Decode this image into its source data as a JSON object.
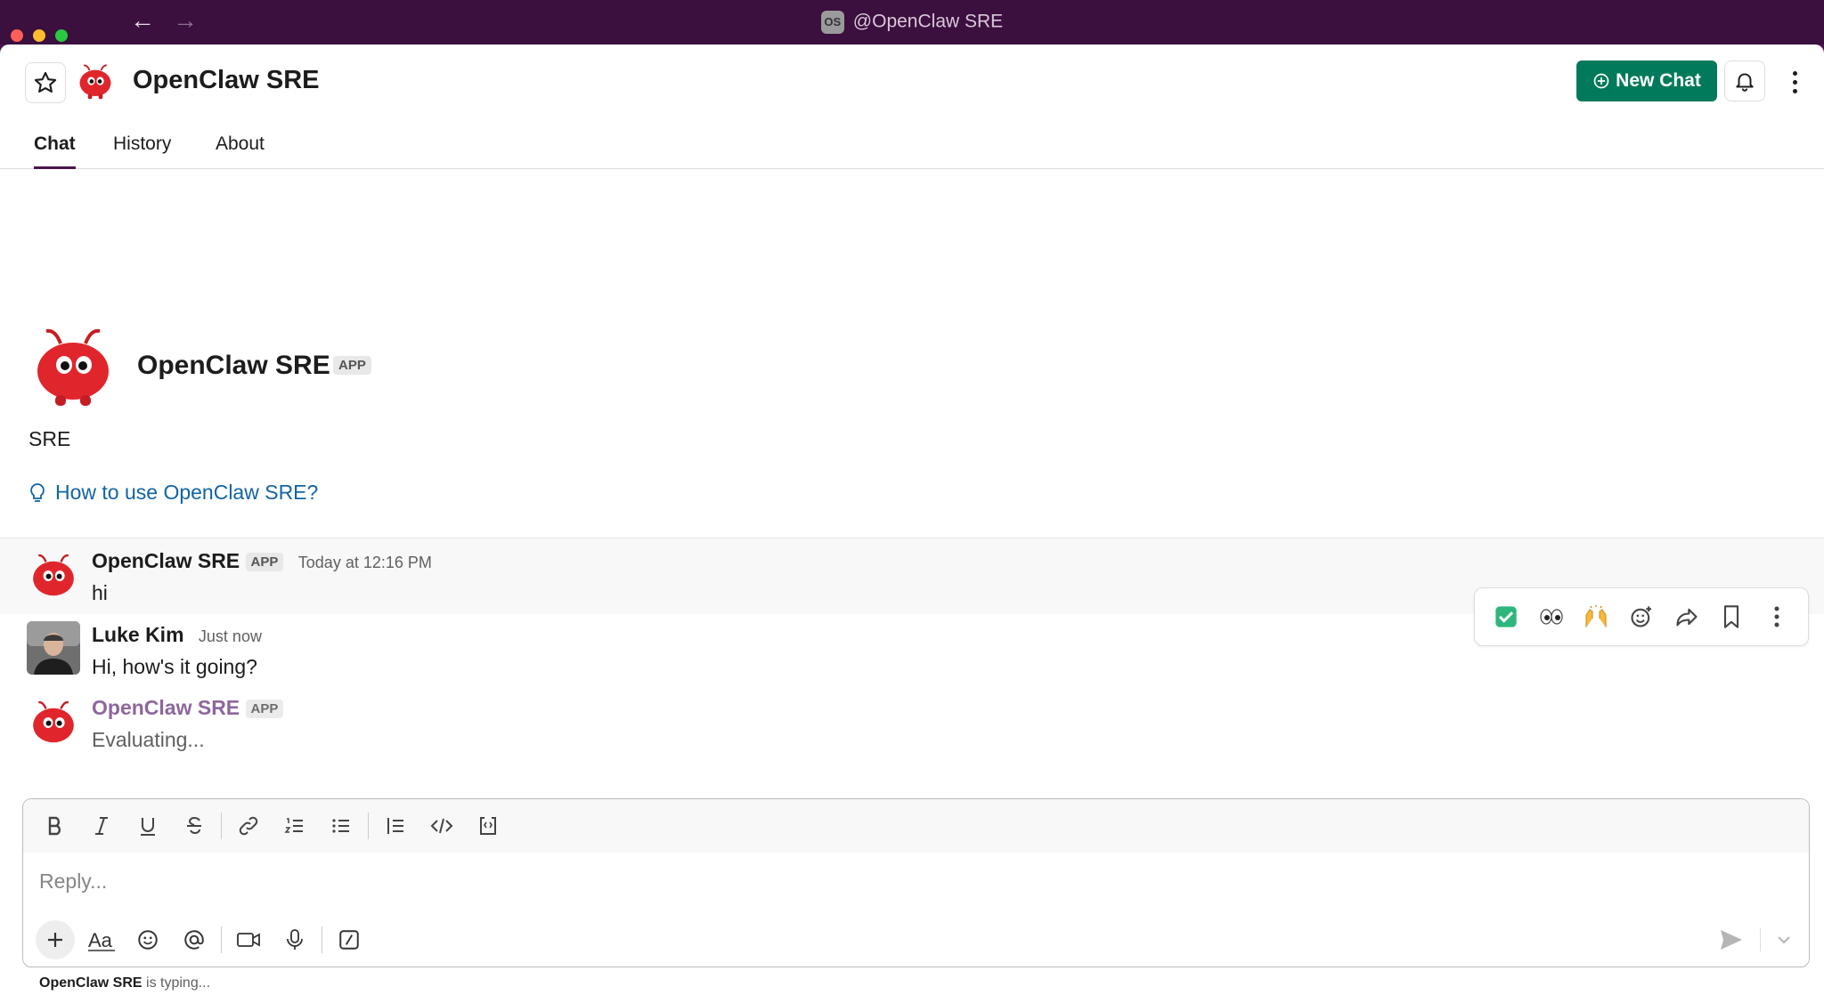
{
  "window": {
    "title": "@OpenClaw SRE",
    "workspace_badge": "OS"
  },
  "header": {
    "title": "OpenClaw SRE",
    "new_chat_label": "New Chat"
  },
  "tabs": [
    {
      "label": "Chat"
    },
    {
      "label": "History"
    },
    {
      "label": "About"
    }
  ],
  "intro": {
    "name": "OpenClaw SRE",
    "tag": "APP",
    "description": "SRE",
    "howto_link": "How to use OpenClaw SRE?"
  },
  "messages": [
    {
      "author": "OpenClaw SRE",
      "tag": "APP",
      "time": "Today at 12:16 PM",
      "text": "hi"
    },
    {
      "author": "Luke Kim",
      "time": "Just now",
      "text": "Hi, how's it going?"
    },
    {
      "author": "OpenClaw SRE",
      "tag": "APP",
      "text": "Evaluating..."
    }
  ],
  "composer": {
    "placeholder": "Reply...",
    "typing_name": "OpenClaw SRE",
    "typing_suffix": " is typing..."
  },
  "colors": {
    "brand": "#4a154b",
    "accent_green": "#007a5a",
    "link": "#1264a3",
    "bot_red": "#e0262c"
  },
  "icons": {
    "header": [
      "star-icon",
      "bell-icon",
      "kebab-icon"
    ],
    "hover_toolbar": [
      "check-emoji-icon",
      "eyes-emoji-icon",
      "raised-hands-emoji-icon",
      "add-reaction-icon",
      "forward-icon",
      "bookmark-icon",
      "more-icon"
    ],
    "format": [
      "bold-icon",
      "italic-icon",
      "underline-icon",
      "strikethrough-icon",
      "link-icon",
      "ordered-list-icon",
      "bullet-list-icon",
      "blockquote-icon",
      "code-icon",
      "code-block-icon"
    ],
    "composer": [
      "plus-icon",
      "text-format-icon",
      "emoji-icon",
      "mention-icon",
      "video-icon",
      "microphone-icon",
      "slash-command-icon",
      "send-icon",
      "chevron-down-icon"
    ]
  }
}
